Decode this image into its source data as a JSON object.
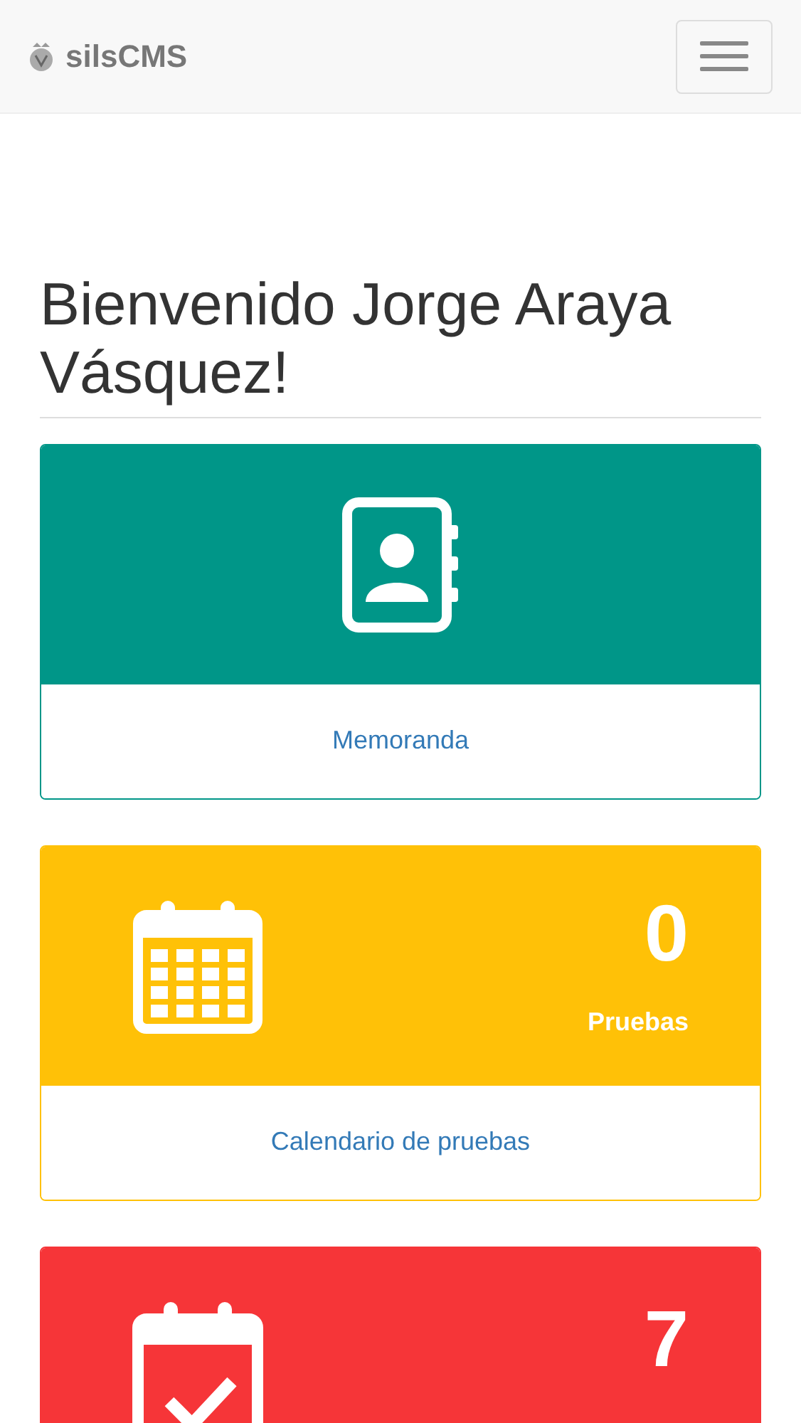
{
  "navbar": {
    "brand": "silsCMS"
  },
  "heading": "Bienvenido Jorge Araya Vásquez!",
  "panels": [
    {
      "kind": "link",
      "color": "#009688",
      "link": "Memoranda"
    },
    {
      "kind": "stat",
      "color": "#ffc107",
      "count": "0",
      "label": "Pruebas",
      "link": "Calendario de pruebas"
    },
    {
      "kind": "stat",
      "color": "#f63538",
      "count": "7"
    }
  ]
}
